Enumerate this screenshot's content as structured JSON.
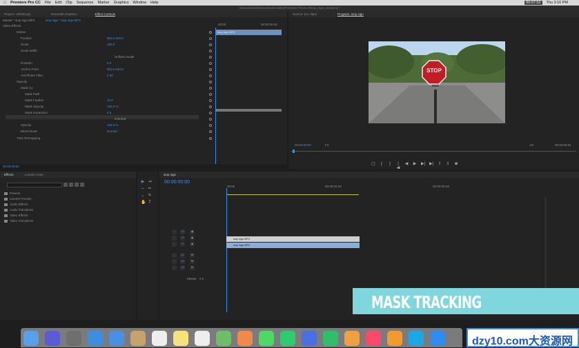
{
  "menubar": {
    "app_name": "Premiere Pro CC",
    "menus": [
      "File",
      "Edit",
      "Clip",
      "Sequence",
      "Marker",
      "Graphics",
      "Window",
      "Help"
    ],
    "time_display": "00:07:53",
    "clock": "Thu 3:16 PM"
  },
  "window_title": "/Users/admin/Documents/Adobe/Premiere Pro/11.0/stop_sign_tut.prproj *",
  "effect_controls": {
    "tabs": [
      "Project: Untitled.prj",
      "Essential Graphics",
      "Effect Controls"
    ],
    "source_path": "Master * stop sign.MP4",
    "clip_path": "stop sign * stop sign.MP4",
    "header": "Video Effects",
    "time_start": "00:00",
    "time_end": "00:00:05:00",
    "clip_label": "stop sign.MP4",
    "rows": [
      {
        "label": "Motion",
        "value": ""
      },
      {
        "label": "Position",
        "value": "960.0   540.0"
      },
      {
        "label": "Scale",
        "value": "100.0"
      },
      {
        "label": "Scale Width",
        "value": ""
      },
      {
        "label": "",
        "value": "Uniform Scale"
      },
      {
        "label": "Rotation",
        "value": "0.0"
      },
      {
        "label": "Anchor Point",
        "value": "960.0   540.0"
      },
      {
        "label": "Anti-flicker Filter",
        "value": "0.00"
      },
      {
        "label": "Opacity",
        "value": ""
      },
      {
        "label": "Mask (1)",
        "value": ""
      },
      {
        "label": "Mask Path",
        "value": ""
      },
      {
        "label": "Mask Feather",
        "value": "10.0"
      },
      {
        "label": "Mask Opacity",
        "value": "100.0 %"
      },
      {
        "label": "Mask Expansion",
        "value": "0.0"
      },
      {
        "label": "",
        "value": "Inverted"
      },
      {
        "label": "Opacity",
        "value": "100.0 %"
      },
      {
        "label": "Blend Mode",
        "value": "Normal"
      },
      {
        "label": "Time Remapping",
        "value": ""
      }
    ],
    "bottom_time": "00:00:00:00"
  },
  "program": {
    "tabs": [
      "Source: (no clips)",
      "Program: stop sign"
    ],
    "sign_text": "STOP",
    "timecode": "00:00:00:00",
    "fit": "Fit",
    "quality": "1/4",
    "duration": "00:00:05:01"
  },
  "effects_panel": {
    "tabs": [
      "Effects",
      "Lumetri Color"
    ],
    "folders": [
      "Presets",
      "Lumetri Presets",
      "Audio Effects",
      "Audio Transitions",
      "Video Effects",
      "Video Transitions"
    ]
  },
  "timeline": {
    "tab": "stop sign",
    "timecode": "00:00:00:00",
    "ruler": [
      "00:00",
      "00:00:04:23",
      "00:00:09:23"
    ],
    "clips": [
      "stop sign.MP4",
      "stop sign.MP4"
    ],
    "video_tracks": [
      "V3",
      "V2",
      "V1"
    ],
    "audio_tracks": [
      "A1",
      "A2",
      "A3"
    ],
    "master_label": "Master",
    "master_value": "0.0"
  },
  "banner_text": "MASK TRACKING",
  "watermark": "dzy10.com大资源网",
  "dock_icons": [
    "finder-icon",
    "siri-icon",
    "launchpad-icon",
    "safari-icon",
    "mail-icon",
    "contacts-icon",
    "calendar-icon",
    "notes-icon",
    "reminders-icon",
    "maps-icon",
    "photos-icon",
    "messages-icon",
    "facetime-icon",
    "keynote-icon",
    "numbers-icon",
    "pages-icon",
    "music-icon",
    "books-icon",
    "skype-icon",
    "appstore-icon"
  ],
  "colors": {
    "accent_blue": "#3d8ee0",
    "banner_bg": "#7fd6dc",
    "clip_video": "#8aaed6",
    "clip_audio": "#cccccc"
  }
}
